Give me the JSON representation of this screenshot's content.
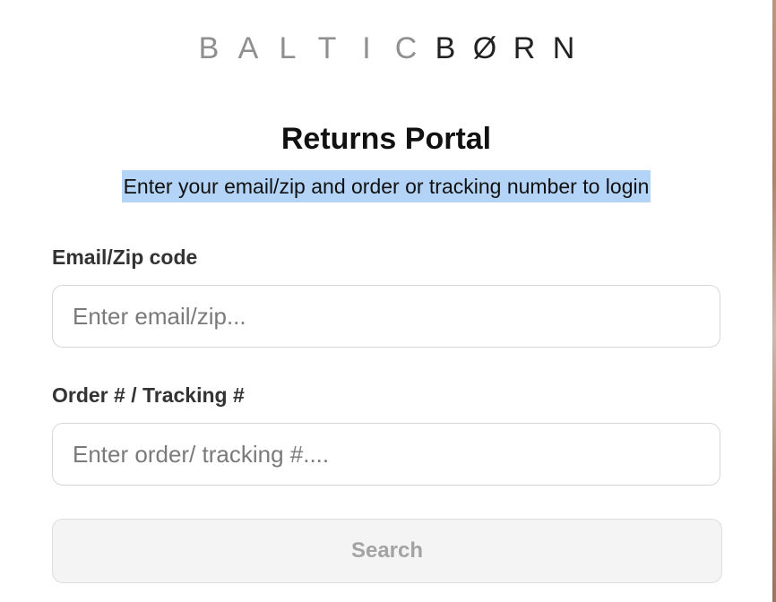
{
  "brand": {
    "letters_light": [
      "B",
      "A",
      "L",
      "T",
      "I",
      "C"
    ],
    "letters_dark": [
      "B",
      "Ø",
      "R",
      "N"
    ]
  },
  "title": "Returns Portal",
  "subtitle": "Enter your email/zip and order or tracking number to login",
  "email": {
    "label": "Email/Zip code",
    "placeholder": "Enter email/zip...",
    "value": ""
  },
  "order": {
    "label": "Order # / Tracking #",
    "placeholder": "Enter order/ tracking #....",
    "value": ""
  },
  "search_button": {
    "label": "Search",
    "enabled": false
  },
  "colors": {
    "highlight": "#b4d4f7",
    "logo_light": "#8f8f8f",
    "logo_dark": "#222222",
    "button_bg": "#f4f4f4",
    "button_text": "#a3a3a3"
  }
}
